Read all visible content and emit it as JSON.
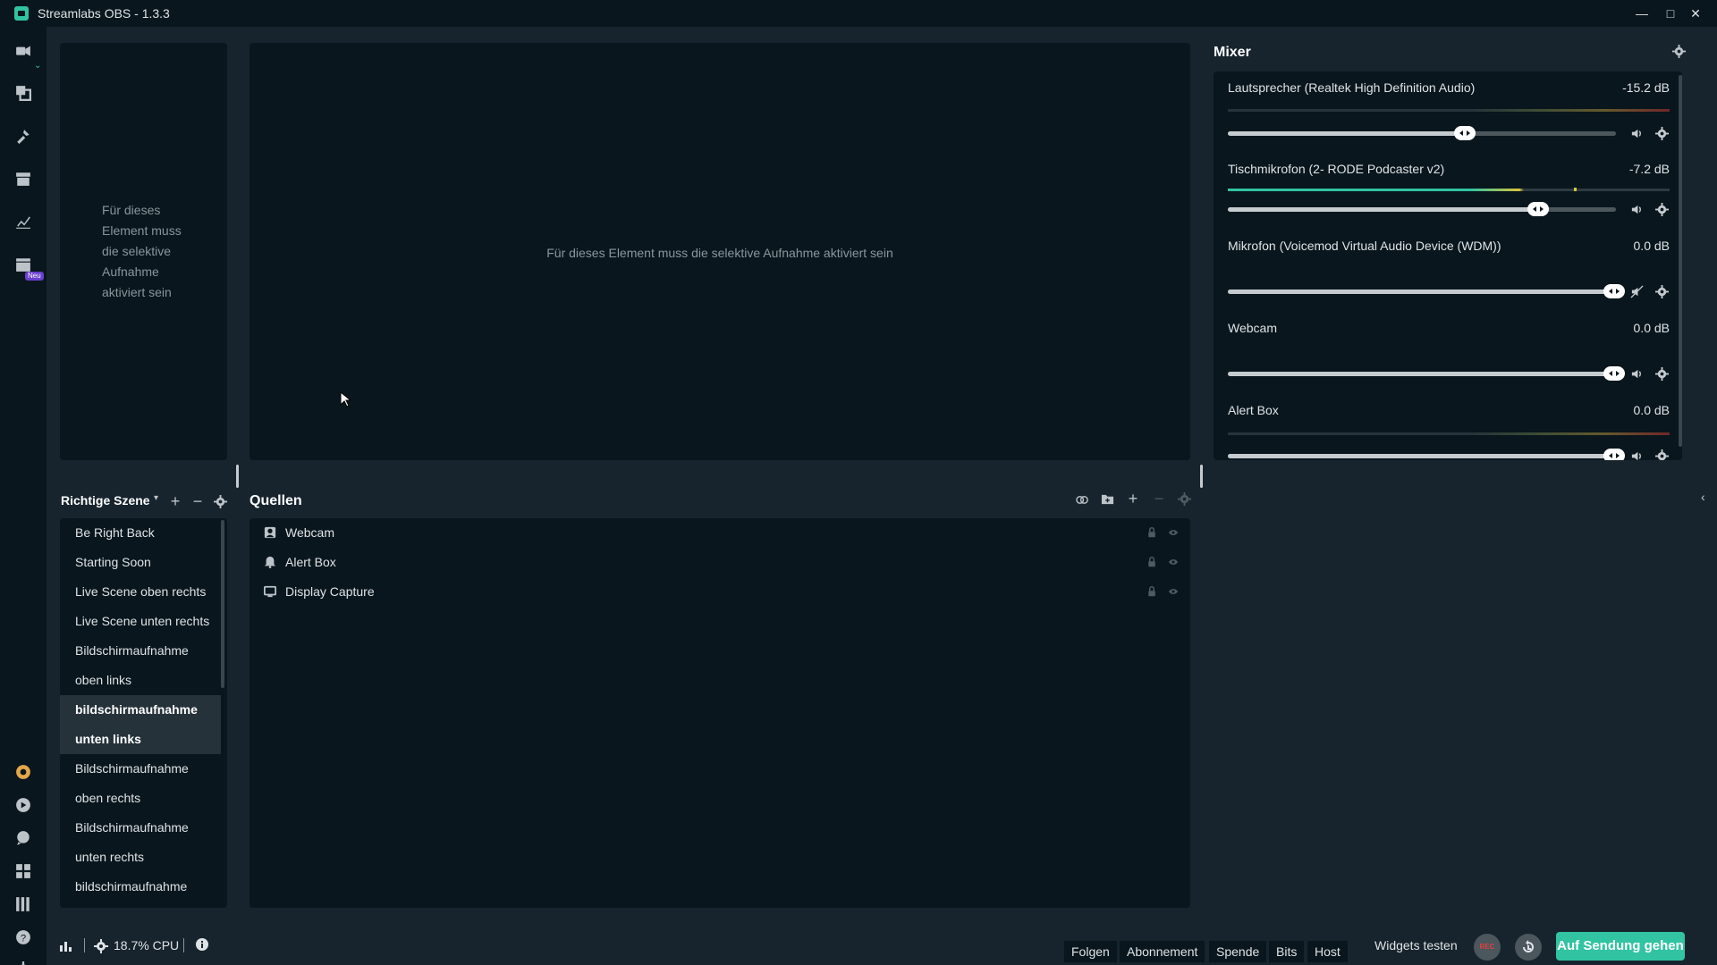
{
  "window": {
    "title": "Streamlabs OBS - 1.3.3"
  },
  "nav": {
    "badge_new": "Neu"
  },
  "preview": {
    "scene_message": [
      "Für dieses",
      "Element muss",
      "die selektive",
      "Aufnahme",
      "aktiviert sein"
    ],
    "main_message": "Für dieses Element muss die selektive Aufnahme aktiviert sein"
  },
  "mixer": {
    "title": "Mixer",
    "sources": [
      {
        "name": "Lautsprecher (Realtek High Definition Audio)",
        "db": "-15.2 dB",
        "volume": 0.61,
        "muted": false
      },
      {
        "name": "Tischmikrofon (2- RODE Podcaster v2)",
        "db": "-7.2 dB",
        "volume": 0.8,
        "muted": false
      },
      {
        "name": "Mikrofon (Voicemod Virtual Audio Device (WDM))",
        "db": "0.0 dB",
        "volume": 1.0,
        "muted": true
      },
      {
        "name": "Webcam",
        "db": "0.0 dB",
        "volume": 1.0,
        "muted": false
      },
      {
        "name": "Alert Box",
        "db": "0.0 dB",
        "volume": 1.0,
        "muted": false
      }
    ]
  },
  "scenes": {
    "header": "Richtige Szene",
    "items": [
      {
        "label": "Be Right Back",
        "active": false
      },
      {
        "label": "Starting Soon",
        "active": false
      },
      {
        "label": "Live Scene oben rechts",
        "active": false
      },
      {
        "label": "Live Scene unten rechts",
        "active": false
      },
      {
        "label": "Bildschirmaufnahme",
        "active": false
      },
      {
        "label": "oben links",
        "active": false
      },
      {
        "label": "bildschirmaufnahme",
        "active": true
      },
      {
        "label": "unten links",
        "active": true
      },
      {
        "label": "Bildschirmaufnahme",
        "active": false
      },
      {
        "label": "oben rechts",
        "active": false
      },
      {
        "label": "Bildschirmaufnahme",
        "active": false
      },
      {
        "label": "unten rechts",
        "active": false
      },
      {
        "label": "bildschirmaufnahme",
        "active": false
      }
    ]
  },
  "sources": {
    "header": "Quellen",
    "items": [
      {
        "label": "Webcam",
        "icon": "webcam-icon"
      },
      {
        "label": "Alert Box",
        "icon": "bell-icon"
      },
      {
        "label": "Display Capture",
        "icon": "monitor-icon"
      }
    ]
  },
  "footer": {
    "cpu": "18.7% CPU",
    "alerts": [
      "Folgen",
      "Abonnement",
      "Spende",
      "Bits",
      "Host"
    ],
    "test_widgets": "Widgets testen",
    "rec": "REC",
    "go_live": "Auf Sendung gehen"
  },
  "colors": {
    "accent": "#31c3a2",
    "panel": "#09161d",
    "background": "#17242d"
  }
}
